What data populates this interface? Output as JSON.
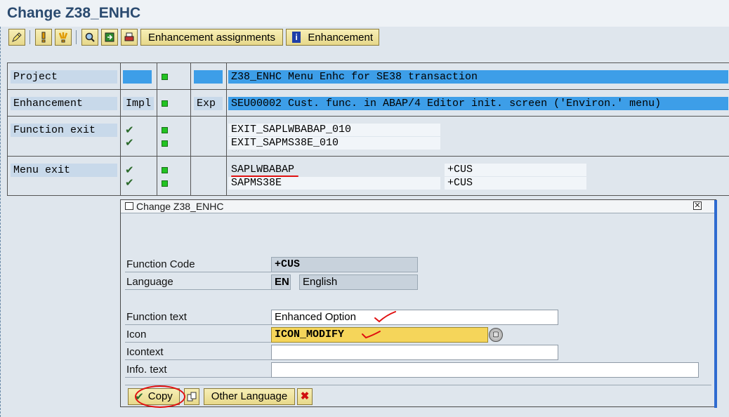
{
  "window": {
    "title": "Change Z38_ENHC"
  },
  "toolbar": {
    "buttons": [
      {
        "icon": "edit-pencil-icon"
      },
      {
        "icon": "exclamation-icon"
      },
      {
        "icon": "multi-exclamation-icon"
      },
      {
        "icon": "search-icon"
      },
      {
        "icon": "save-local-icon"
      },
      {
        "icon": "print-icon"
      }
    ],
    "enhancement_assignments_label": "Enhancement assignments",
    "enhancement_label": "Enhancement",
    "enhancement_icon_glyph": "i"
  },
  "grid": {
    "project": {
      "label": "Project",
      "text": "Z38_ENHC Menu Enhc for SE38 transaction"
    },
    "enhancement": {
      "label": "Enhancement",
      "impl": "Impl",
      "exp": "Exp",
      "text": "SEU00002 Cust. func. in ABAP/4 Editor init. screen ('Environ.' menu)"
    },
    "function_exit": {
      "label": "Function exit",
      "items": [
        "EXIT_SAPLWBABAP_010",
        "EXIT_SAPMS38E_010"
      ]
    },
    "menu_exit": {
      "label": "Menu exit",
      "programs": [
        "SAPLWBABAP",
        "SAPMS38E"
      ],
      "codes": [
        "+CUS",
        "+CUS"
      ]
    }
  },
  "dialog": {
    "title": "Change Z38_ENHC",
    "fields": {
      "function_code": {
        "label": "Function Code",
        "value": "+CUS"
      },
      "language": {
        "label": "Language",
        "code": "EN",
        "name": "English"
      },
      "function_text": {
        "label": "Function text",
        "value": "Enhanced Option"
      },
      "icon": {
        "label": "Icon",
        "value": "ICON_MODIFY"
      },
      "icontext": {
        "label": "Icontext",
        "value": ""
      },
      "info_text": {
        "label": "Info. text",
        "value": ""
      }
    },
    "buttons": {
      "copy": "Copy",
      "other_language": "Other Language"
    }
  },
  "colors": {
    "accent_blue": "#3d9ee8",
    "label_blue": "#c8d9ea",
    "button_yellow": "#f5d55a",
    "status_green": "#22c322",
    "annotation_red": "#e01010"
  }
}
